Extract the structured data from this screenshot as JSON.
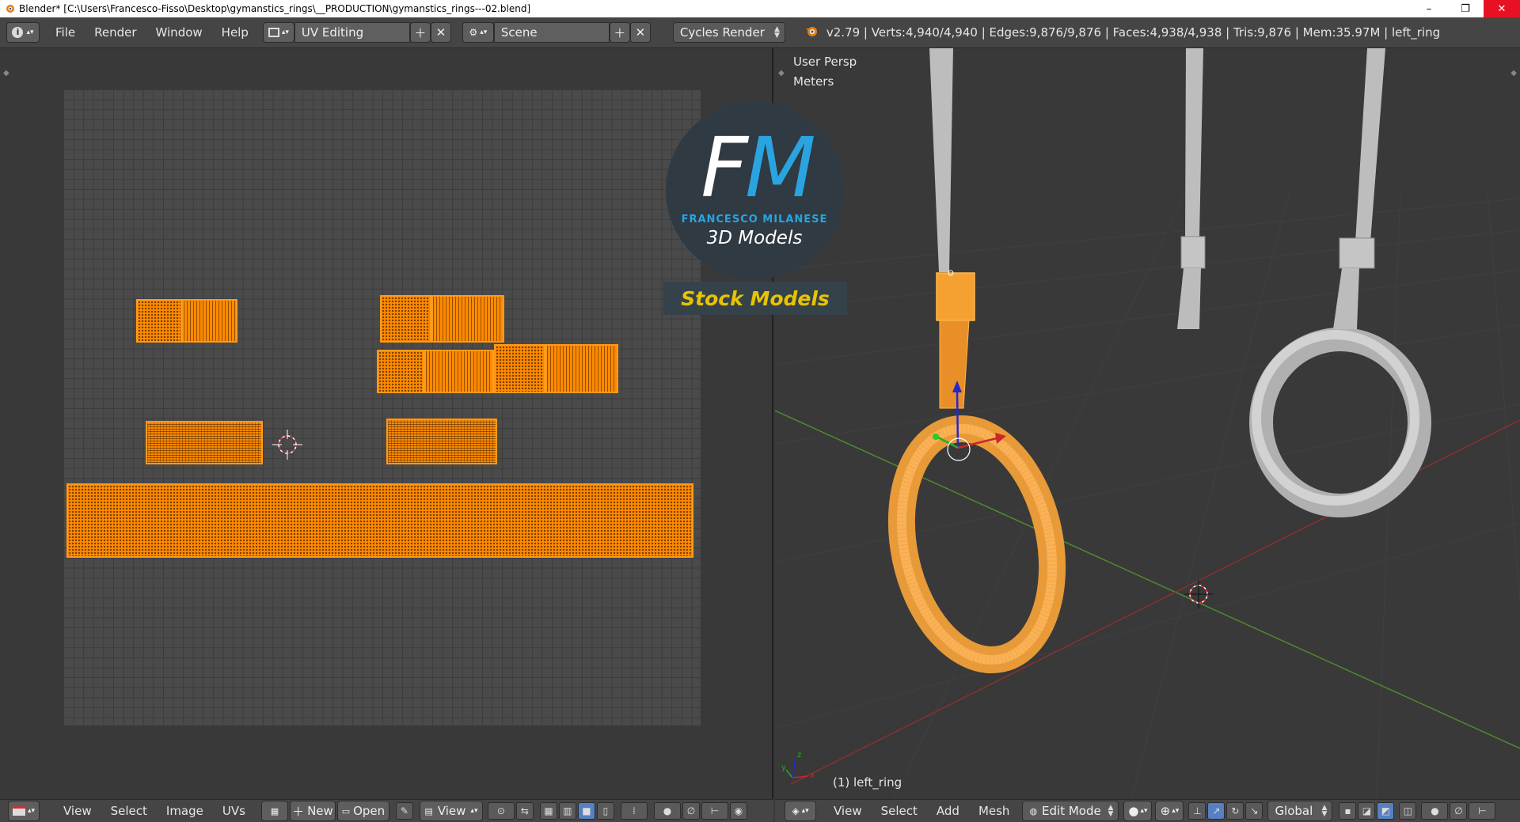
{
  "window": {
    "title": "Blender* [C:\\Users\\Francesco-Fisso\\Desktop\\gymanstics_rings\\__PRODUCTION\\gymanstics_rings---02.blend]",
    "minimize": "–",
    "restore": "❐",
    "close": "✕"
  },
  "info_header": {
    "menus": [
      "File",
      "Render",
      "Window",
      "Help"
    ],
    "screen_layout": "UV Editing",
    "scene": "Scene",
    "render_engine": "Cycles Render",
    "stats": "v2.79 | Verts:4,940/4,940 | Edges:9,876/9,876 | Faces:4,938/4,938 | Tris:9,876 | Mem:35.97M | left_ring"
  },
  "watermark": {
    "letters_f": "F",
    "letters_m": "M",
    "name": "FRANCESCO MILANESE",
    "subtitle": "3D Models",
    "stock": "Stock Models"
  },
  "viewport": {
    "view_name": "User Persp",
    "units": "Meters",
    "object_label": "(1) left_ring"
  },
  "uv_header": {
    "menus": [
      "View",
      "Select",
      "Image",
      "UVs"
    ],
    "new_label": "New",
    "open_label": "Open",
    "view_label": "View"
  },
  "viewport_header": {
    "menus": [
      "View",
      "Select",
      "Add",
      "Mesh"
    ],
    "mode": "Edit Mode",
    "orientation": "Global"
  },
  "colors": {
    "selection": "#ff8a00",
    "background": "#393939",
    "header": "#454545",
    "watermark_blue": "#29a4e0",
    "watermark_yellow": "#e8c400"
  }
}
